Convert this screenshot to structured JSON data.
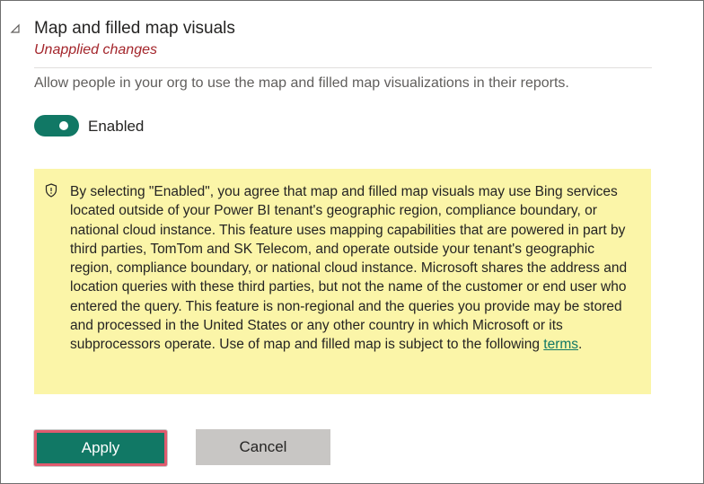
{
  "section": {
    "title": "Map and filled map visuals",
    "status": "Unapplied changes",
    "description": "Allow people in your org to use the map and filled map visualizations in their reports."
  },
  "toggle": {
    "state": "on",
    "label": "Enabled"
  },
  "notice": {
    "icon": "shield-info-icon",
    "text": "By selecting \"Enabled\", you agree that map and filled map visuals may use Bing services located outside of your Power BI tenant's geographic region, compliance boundary, or national cloud instance. This feature uses mapping capabilities that are powered in part by third parties, TomTom and SK Telecom, and operate outside your tenant's geographic region, compliance boundary, or national cloud instance. Microsoft shares the address and location queries with these third parties, but not the name of the customer or end user who entered the query. This feature is non-regional and the queries you provide may be stored and processed in the United States or any other country in which Microsoft or its subprocessors operate. Use of map and filled map is subject to the following ",
    "link_text": "terms",
    "trailing_text": "."
  },
  "buttons": {
    "apply_label": "Apply",
    "cancel_label": "Cancel"
  },
  "colors": {
    "accent": "#117865",
    "unapplied": "#a4262c",
    "notice_background": "#fbf5a8",
    "apply_highlight": "#e05a6e",
    "cancel_background": "#c8c6c4"
  }
}
